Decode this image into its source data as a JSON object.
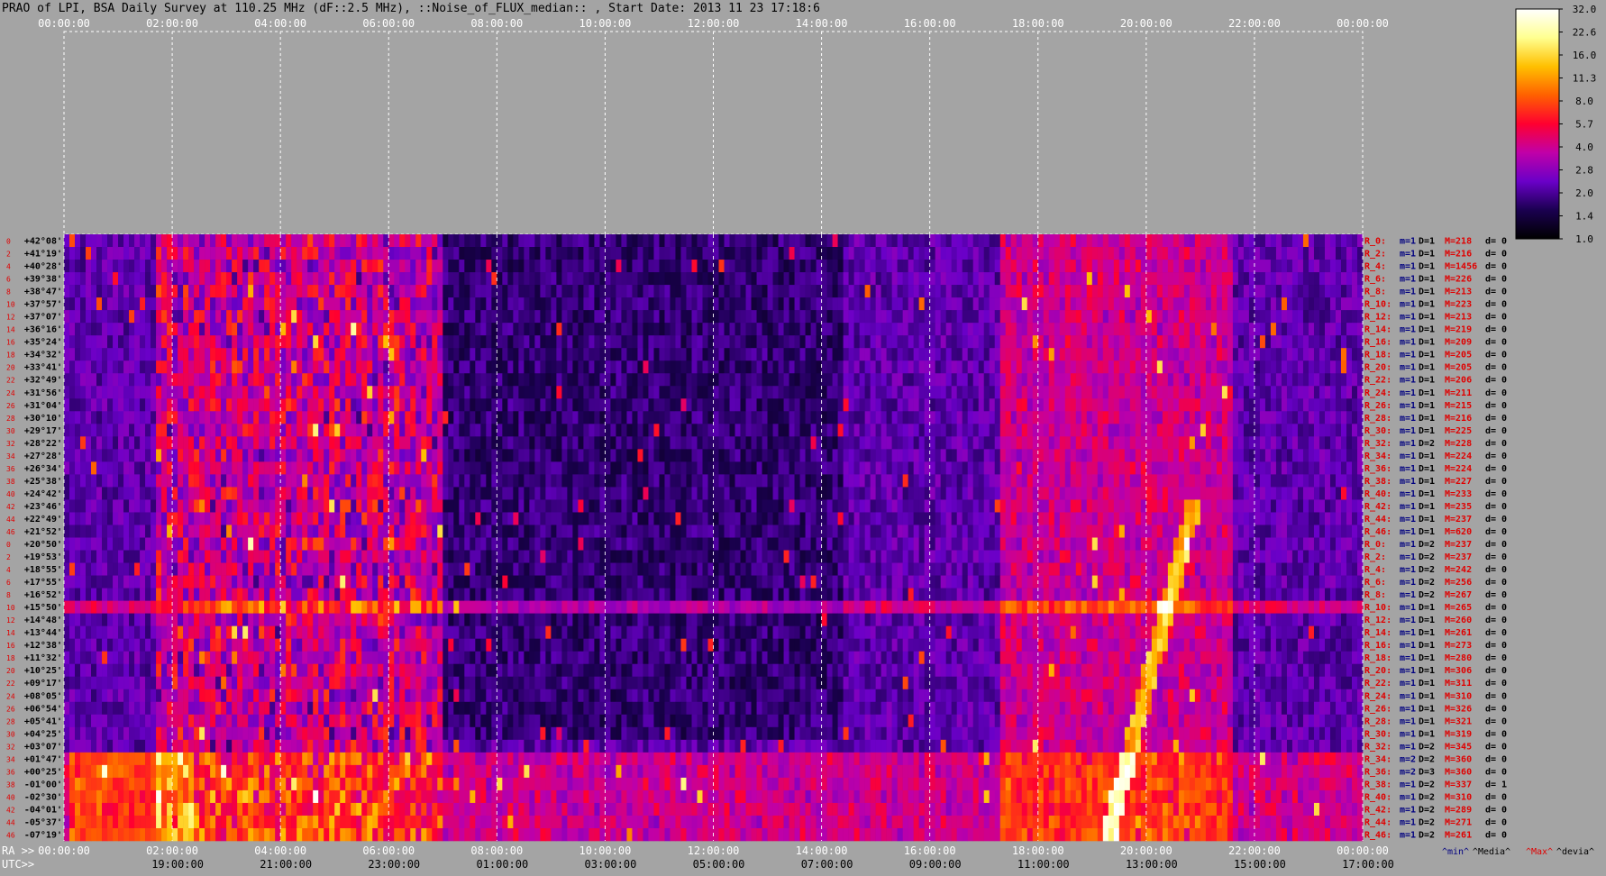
{
  "header": {
    "title": "PRAO of LPI, BSA Daily Survey at 110.25 MHz (dF::2.5 MHz), ::Noise_of_FLUX_median:: , Start Date: 2013 11 23 17:18:6"
  },
  "chart_data": {
    "type": "heatmap",
    "title": "PRAO of LPI, BSA Daily Survey at 110.25 MHz (dF::2.5 MHz), ::Noise_of_FLUX_median:: , Start Date: 2013 11 23 17:18:6",
    "top_axis": {
      "ticks": [
        "00:00:00",
        "02:00:00",
        "04:00:00",
        "06:00:00",
        "08:00:00",
        "10:00:00",
        "12:00:00",
        "14:00:00",
        "16:00:00",
        "18:00:00",
        "20:00:00",
        "22:00:00",
        "00:00:00"
      ]
    },
    "bottom_axis": {
      "ra_label": "RA >>",
      "ra_ticks": [
        "00:00:00",
        "02:00:00",
        "04:00:00",
        "06:00:00",
        "08:00:00",
        "10:00:00",
        "12:00:00",
        "14:00:00",
        "16:00:00",
        "18:00:00",
        "20:00:00",
        "22:00:00",
        "00:00:00"
      ],
      "utc_label": "UTC>>",
      "utc_ticks": [
        "19:00:00",
        "21:00:00",
        "23:00:00",
        "01:00:00",
        "03:00:00",
        "05:00:00",
        "07:00:00",
        "09:00:00",
        "11:00:00",
        "13:00:00",
        "15:00:00",
        "17:00:00"
      ]
    },
    "declinations": [
      "+42°08'",
      "+41°19'",
      "+40°28'",
      "+39°38'",
      "+38°47'",
      "+37°57'",
      "+37°07'",
      "+36°16'",
      "+35°24'",
      "+34°32'",
      "+33°41'",
      "+32°49'",
      "+31°56'",
      "+31°04'",
      "+30°10'",
      "+29°17'",
      "+28°22'",
      "+27°28'",
      "+26°34'",
      "+25°38'",
      "+24°42'",
      "+23°46'",
      "+22°49'",
      "+21°52'",
      "+20°50'",
      "+19°53'",
      "+18°55'",
      "+17°55'",
      "+16°52'",
      "+15°50'",
      "+14°48'",
      "+13°44'",
      "+12°38'",
      "+11°32'",
      "+10°25'",
      "+09°17'",
      "+08°05'",
      "+06°54'",
      "+05°41'",
      "+04°25'",
      "+03°07'",
      "+01°47'",
      "+00°25'",
      "-01°00'",
      "-02°30'",
      "-04°01'",
      "-05°37'",
      "-07°19'"
    ],
    "row_index_labels": [
      "0",
      "2",
      "4",
      "6",
      "8",
      "10",
      "12",
      "14",
      "16",
      "18",
      "20",
      "22",
      "24",
      "26",
      "28",
      "30",
      "32",
      "34",
      "36",
      "38",
      "40",
      "42",
      "44",
      "46",
      "0",
      "2",
      "4",
      "6",
      "8",
      "10",
      "12",
      "14",
      "16",
      "18",
      "20",
      "22",
      "24",
      "26",
      "28",
      "30",
      "32",
      "34",
      "36",
      "38",
      "40",
      "42",
      "44",
      "46"
    ],
    "row_stats": [
      {
        "ray": "R_0:",
        "min": "m=1",
        "dev": "D=1",
        "max": "M=218",
        "d": "d= 0"
      },
      {
        "ray": "R_2:",
        "min": "m=1",
        "dev": "D=1",
        "max": "M=216",
        "d": "d= 0"
      },
      {
        "ray": "R_4:",
        "min": "m=1",
        "dev": "D=1",
        "max": "M=1456",
        "d": "d= 0"
      },
      {
        "ray": "R_6:",
        "min": "m=1",
        "dev": "D=1",
        "max": "M=226",
        "d": "d= 0"
      },
      {
        "ray": "R_8:",
        "min": "m=1",
        "dev": "D=1",
        "max": "M=213",
        "d": "d= 0"
      },
      {
        "ray": "R_10:",
        "min": "m=1",
        "dev": "D=1",
        "max": "M=223",
        "d": "d= 0"
      },
      {
        "ray": "R_12:",
        "min": "m=1",
        "dev": "D=1",
        "max": "M=213",
        "d": "d= 0"
      },
      {
        "ray": "R_14:",
        "min": "m=1",
        "dev": "D=1",
        "max": "M=219",
        "d": "d= 0"
      },
      {
        "ray": "R_16:",
        "min": "m=1",
        "dev": "D=1",
        "max": "M=209",
        "d": "d= 0"
      },
      {
        "ray": "R_18:",
        "min": "m=1",
        "dev": "D=1",
        "max": "M=205",
        "d": "d= 0"
      },
      {
        "ray": "R_20:",
        "min": "m=1",
        "dev": "D=1",
        "max": "M=205",
        "d": "d= 0"
      },
      {
        "ray": "R_22:",
        "min": "m=1",
        "dev": "D=1",
        "max": "M=206",
        "d": "d= 0"
      },
      {
        "ray": "R_24:",
        "min": "m=1",
        "dev": "D=1",
        "max": "M=211",
        "d": "d= 0"
      },
      {
        "ray": "R_26:",
        "min": "m=1",
        "dev": "D=1",
        "max": "M=215",
        "d": "d= 0"
      },
      {
        "ray": "R_28:",
        "min": "m=1",
        "dev": "D=1",
        "max": "M=216",
        "d": "d= 0"
      },
      {
        "ray": "R_30:",
        "min": "m=1",
        "dev": "D=1",
        "max": "M=225",
        "d": "d= 0"
      },
      {
        "ray": "R_32:",
        "min": "m=1",
        "dev": "D=2",
        "max": "M=228",
        "d": "d= 0"
      },
      {
        "ray": "R_34:",
        "min": "m=1",
        "dev": "D=1",
        "max": "M=224",
        "d": "d= 0"
      },
      {
        "ray": "R_36:",
        "min": "m=1",
        "dev": "D=1",
        "max": "M=224",
        "d": "d= 0"
      },
      {
        "ray": "R_38:",
        "min": "m=1",
        "dev": "D=1",
        "max": "M=227",
        "d": "d= 0"
      },
      {
        "ray": "R_40:",
        "min": "m=1",
        "dev": "D=1",
        "max": "M=233",
        "d": "d= 0"
      },
      {
        "ray": "R_42:",
        "min": "m=1",
        "dev": "D=1",
        "max": "M=235",
        "d": "d= 0"
      },
      {
        "ray": "R_44:",
        "min": "m=1",
        "dev": "D=1",
        "max": "M=237",
        "d": "d= 0"
      },
      {
        "ray": "R_46:",
        "min": "m=1",
        "dev": "D=1",
        "max": "M=620",
        "d": "d= 0"
      },
      {
        "ray": "R_0:",
        "min": "m=1",
        "dev": "D=2",
        "max": "M=237",
        "d": "d= 0"
      },
      {
        "ray": "R_2:",
        "min": "m=1",
        "dev": "D=2",
        "max": "M=237",
        "d": "d= 0"
      },
      {
        "ray": "R_4:",
        "min": "m=1",
        "dev": "D=2",
        "max": "M=242",
        "d": "d= 0"
      },
      {
        "ray": "R_6:",
        "min": "m=1",
        "dev": "D=2",
        "max": "M=256",
        "d": "d= 0"
      },
      {
        "ray": "R_8:",
        "min": "m=1",
        "dev": "D=2",
        "max": "M=267",
        "d": "d= 0"
      },
      {
        "ray": "R_10:",
        "min": "m=1",
        "dev": "D=1",
        "max": "M=265",
        "d": "d= 0"
      },
      {
        "ray": "R_12:",
        "min": "m=1",
        "dev": "D=1",
        "max": "M=260",
        "d": "d= 0"
      },
      {
        "ray": "R_14:",
        "min": "m=1",
        "dev": "D=1",
        "max": "M=261",
        "d": "d= 0"
      },
      {
        "ray": "R_16:",
        "min": "m=1",
        "dev": "D=1",
        "max": "M=273",
        "d": "d= 0"
      },
      {
        "ray": "R_18:",
        "min": "m=1",
        "dev": "D=1",
        "max": "M=280",
        "d": "d= 0"
      },
      {
        "ray": "R_20:",
        "min": "m=1",
        "dev": "D=1",
        "max": "M=306",
        "d": "d= 0"
      },
      {
        "ray": "R_22:",
        "min": "m=1",
        "dev": "D=1",
        "max": "M=311",
        "d": "d= 0"
      },
      {
        "ray": "R_24:",
        "min": "m=1",
        "dev": "D=1",
        "max": "M=310",
        "d": "d= 0"
      },
      {
        "ray": "R_26:",
        "min": "m=1",
        "dev": "D=1",
        "max": "M=326",
        "d": "d= 0"
      },
      {
        "ray": "R_28:",
        "min": "m=1",
        "dev": "D=1",
        "max": "M=321",
        "d": "d= 0"
      },
      {
        "ray": "R_30:",
        "min": "m=1",
        "dev": "D=1",
        "max": "M=319",
        "d": "d= 0"
      },
      {
        "ray": "R_32:",
        "min": "m=1",
        "dev": "D=2",
        "max": "M=345",
        "d": "d= 0"
      },
      {
        "ray": "R_34:",
        "min": "m=2",
        "dev": "D=2",
        "max": "M=360",
        "d": "d= 0"
      },
      {
        "ray": "R_36:",
        "min": "m=2",
        "dev": "D=3",
        "max": "M=360",
        "d": "d= 0"
      },
      {
        "ray": "R_38:",
        "min": "m=1",
        "dev": "D=2",
        "max": "M=337",
        "d": "d= 1"
      },
      {
        "ray": "R_40:",
        "min": "m=1",
        "dev": "D=2",
        "max": "M=310",
        "d": "d= 0"
      },
      {
        "ray": "R_42:",
        "min": "m=1",
        "dev": "D=2",
        "max": "M=289",
        "d": "d= 0"
      },
      {
        "ray": "R_44:",
        "min": "m=1",
        "dev": "D=2",
        "max": "M=271",
        "d": "d= 0"
      },
      {
        "ray": "R_46:",
        "min": "m=1",
        "dev": "D=2",
        "max": "M=261",
        "d": "d= 0"
      }
    ],
    "stats_footer": [
      "^min^",
      "^Media^",
      "^Max^",
      "^devia^"
    ],
    "colorbar": {
      "ticks": [
        "32.0",
        "22.6",
        "16.0",
        "11.3",
        "8.0",
        "5.7",
        "4.0",
        "2.8",
        "2.0",
        "1.4",
        "1.0"
      ],
      "scale": "log",
      "range": [
        1.0,
        32.0
      ],
      "colors": [
        "#000000",
        "#1a0050",
        "#6a00c8",
        "#c000a8",
        "#ff0030",
        "#ff6000",
        "#ffc000",
        "#ffff90",
        "#ffffff"
      ]
    },
    "grid": true
  },
  "colors": {
    "background": "#a4a4a4",
    "text_dark": "#000000",
    "text_white": "#ffffff",
    "text_red": "#e00000",
    "text_blue": "#000080"
  }
}
